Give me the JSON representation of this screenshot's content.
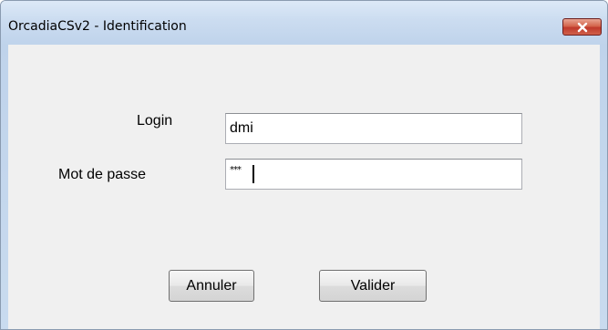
{
  "window": {
    "title": "OrcadiaCSv2 - Identification"
  },
  "form": {
    "login_label": "Login",
    "login_value": "dmi",
    "password_label": "Mot de passe",
    "password_value": "***"
  },
  "buttons": {
    "cancel_label": "Annuler",
    "submit_label": "Valider"
  },
  "icons": {
    "close": "close-icon"
  },
  "colors": {
    "titlebar": "#cbdcf0",
    "close_button": "#c0392b",
    "dialog_background": "#f0f0f0"
  }
}
